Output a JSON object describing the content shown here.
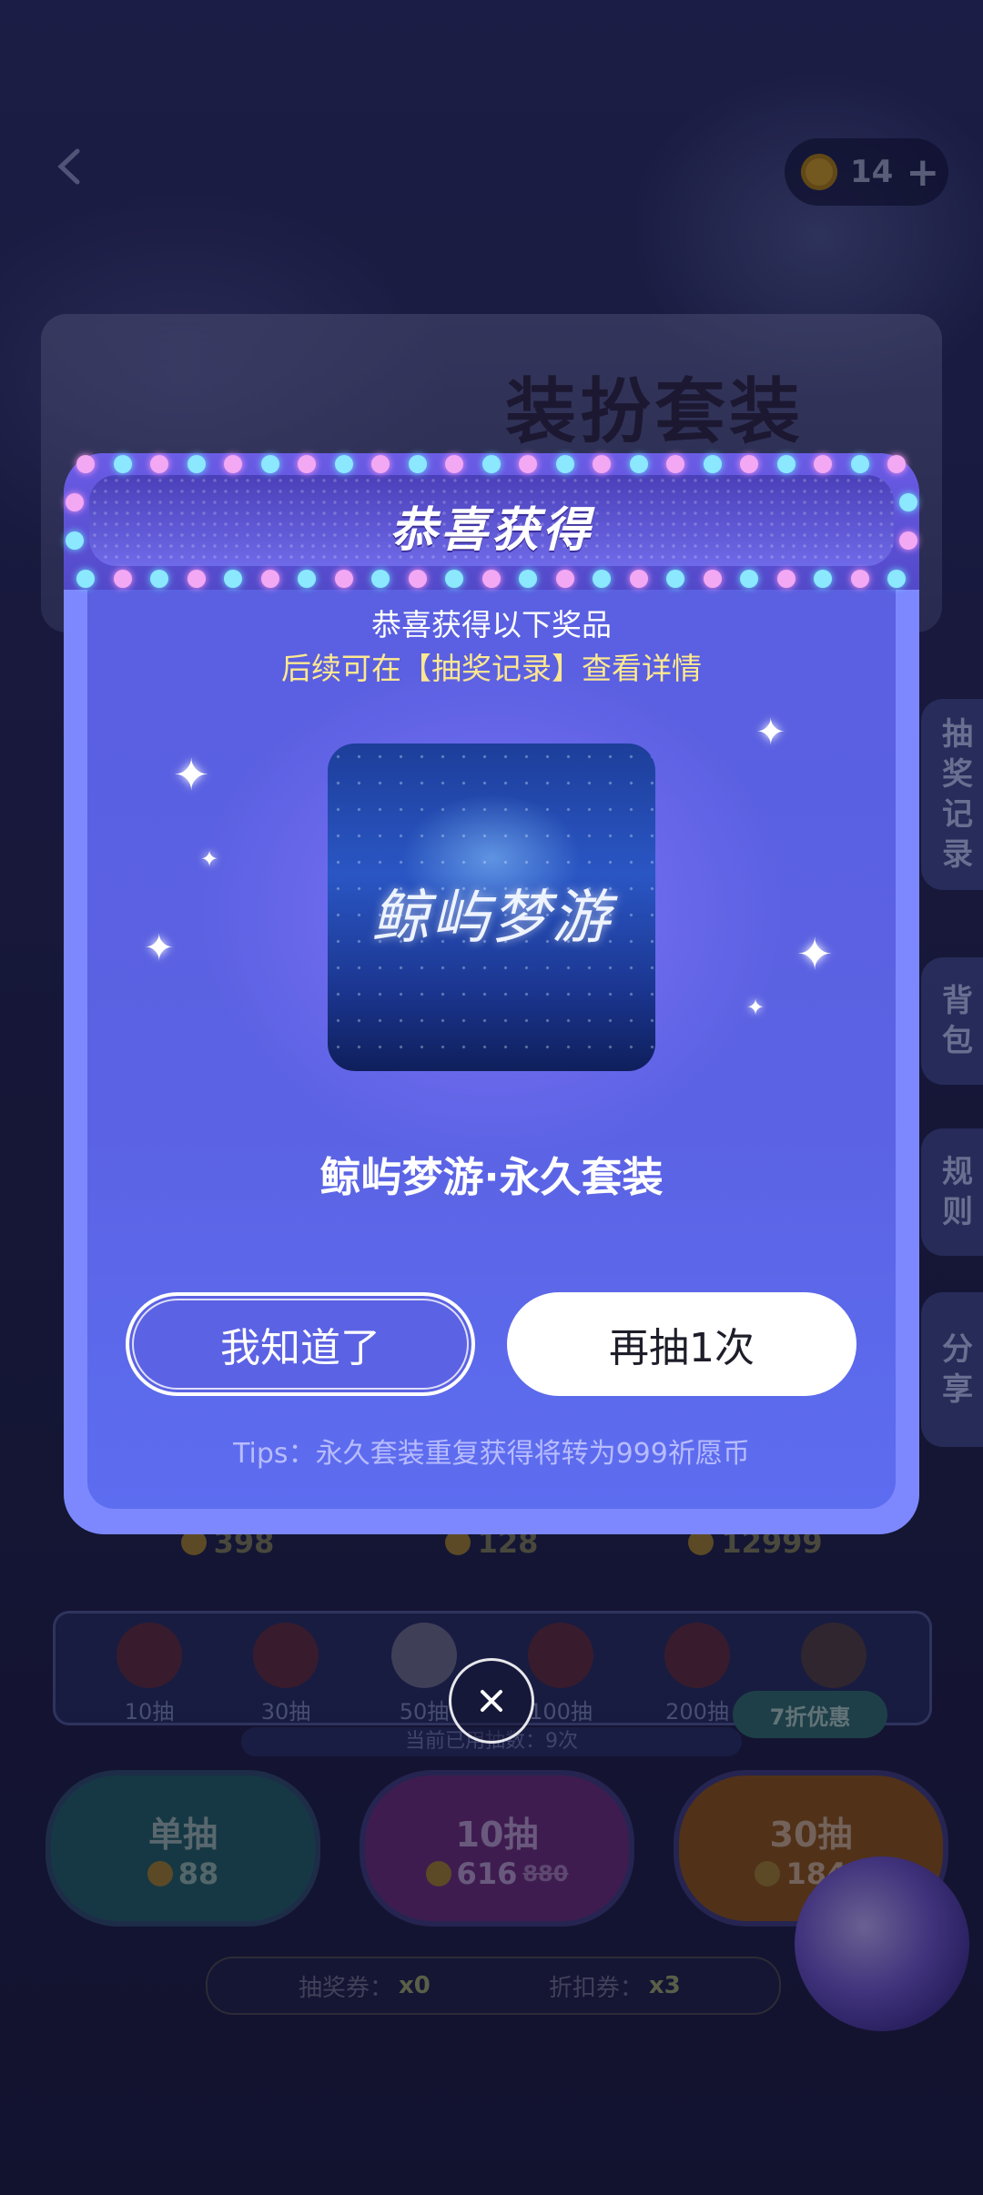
{
  "topbar": {
    "coin_count": "14",
    "plus": "+"
  },
  "banner": {
    "title": "装扮套装"
  },
  "side_tabs": [
    "抽奖记录",
    "背包",
    "规则",
    "分享"
  ],
  "prices_row": [
    "398",
    "128",
    "12999"
  ],
  "tiers": [
    {
      "label": "10抽"
    },
    {
      "label": "30抽"
    },
    {
      "label": "50抽"
    },
    {
      "label": "100抽"
    },
    {
      "label": "200抽"
    },
    {
      "label": ""
    }
  ],
  "tier_discount": "7折优惠",
  "used_count": "当前已用抽数：9次",
  "draw_buttons": [
    {
      "title": "单抽",
      "price": "88",
      "old_price": ""
    },
    {
      "title": "10抽",
      "price": "616",
      "old_price": "880"
    },
    {
      "title": "30抽",
      "price": "1848",
      "old_price": ""
    }
  ],
  "tickets": {
    "draw_label": "抽奖券：",
    "draw_count": "x0",
    "discount_label": "折扣券：",
    "discount_count": "x3"
  },
  "modal": {
    "title": "恭喜获得",
    "subtitle": "恭喜获得以下奖品",
    "hint": "后续可在【抽奖记录】查看详情",
    "prize_image_text": "鲸屿梦游",
    "prize_name": "鲸屿梦游·永久套装",
    "ok_button": "我知道了",
    "again_button": "再抽1次",
    "tips": "Tips：永久套装重复获得将转为999祈愿币"
  },
  "colors": {
    "modal_bg": "#5b62e3",
    "hint": "#ffe98f",
    "bulb_pink": "#f3a8f3",
    "bulb_cyan": "#8be8ff"
  }
}
